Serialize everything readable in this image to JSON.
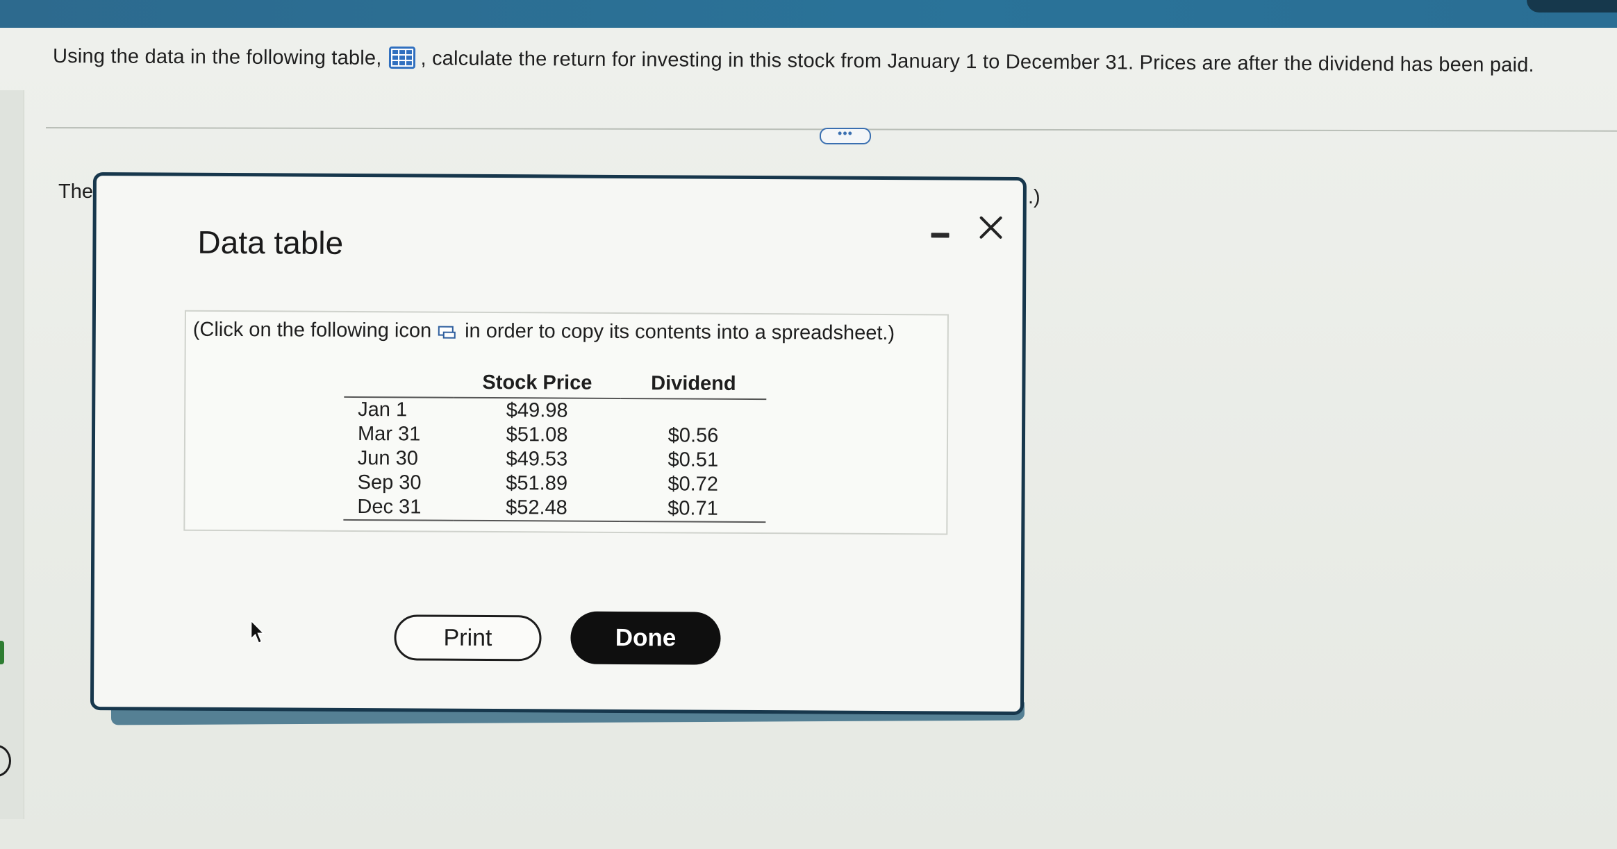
{
  "question": {
    "text_before_icon": "Using the data in the following table,",
    "text_after_icon": ", calculate the return for investing in this stock from January 1 to December 31. Prices are after the dividend has been paid.",
    "table_icon": "grid-table-icon"
  },
  "expand_button": {
    "label": "•••"
  },
  "background_fragments": {
    "left_text": "The",
    "right_text": ".)"
  },
  "dialog": {
    "title": "Data table",
    "minimize_icon": "minimize-icon",
    "close_icon": "close-icon",
    "instruction_before_icon": "(Click on the following icon",
    "instruction_after_icon": "in order to copy its contents into a spreadsheet.)",
    "copy_icon": "copy-icon",
    "table": {
      "headers": [
        "",
        "Stock Price",
        "Dividend"
      ],
      "rows": [
        [
          "Jan 1",
          "$49.98",
          ""
        ],
        [
          "Mar 31",
          "$51.08",
          "$0.56"
        ],
        [
          "Jun 30",
          "$49.53",
          "$0.51"
        ],
        [
          "Sep 30",
          "$51.89",
          "$0.72"
        ],
        [
          "Dec 31",
          "$52.48",
          "$0.71"
        ]
      ]
    },
    "print_label": "Print",
    "done_label": "Done"
  },
  "colors": {
    "top_bar": "#2a7399",
    "dialog_border": "#17374c",
    "done_button": "#0f0f0f",
    "icon_blue": "#2f6fbf"
  }
}
